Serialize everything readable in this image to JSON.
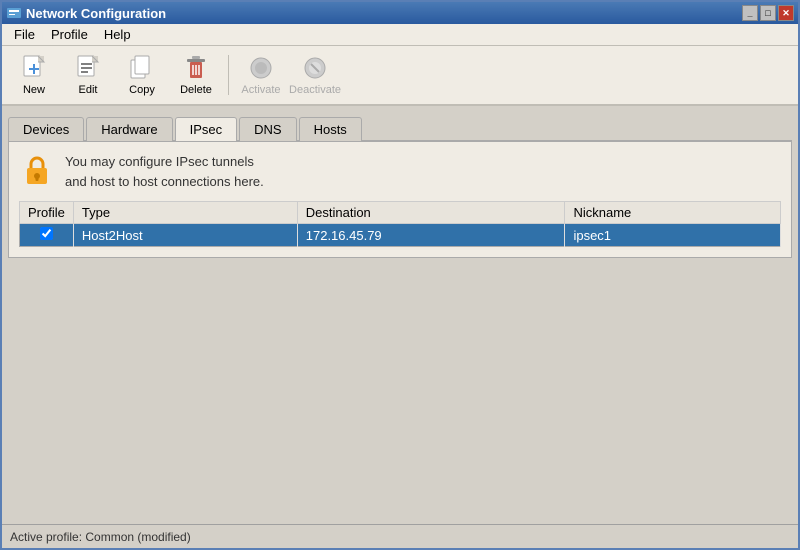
{
  "titlebar": {
    "title": "Network Configuration",
    "minimize_label": "_",
    "maximize_label": "□",
    "close_label": "✕"
  },
  "menubar": {
    "items": [
      {
        "id": "file",
        "label": "File"
      },
      {
        "id": "profile",
        "label": "Profile"
      },
      {
        "id": "help",
        "label": "Help"
      }
    ]
  },
  "toolbar": {
    "new_label": "New",
    "edit_label": "Edit",
    "copy_label": "Copy",
    "delete_label": "Delete",
    "activate_label": "Activate",
    "deactivate_label": "Deactivate"
  },
  "tabs": [
    {
      "id": "devices",
      "label": "Devices"
    },
    {
      "id": "hardware",
      "label": "Hardware"
    },
    {
      "id": "ipsec",
      "label": "IPsec"
    },
    {
      "id": "dns",
      "label": "DNS"
    },
    {
      "id": "hosts",
      "label": "Hosts"
    }
  ],
  "active_tab": "ipsec",
  "info_text_line1": "You may configure IPsec tunnels",
  "info_text_line2": "and host to host connections here.",
  "table": {
    "columns": [
      {
        "id": "profile",
        "label": "Profile"
      },
      {
        "id": "type",
        "label": "Type"
      },
      {
        "id": "destination",
        "label": "Destination"
      },
      {
        "id": "nickname",
        "label": "Nickname"
      }
    ],
    "rows": [
      {
        "checked": true,
        "profile": "",
        "type": "Host2Host",
        "destination": "172.16.45.79",
        "nickname": "ipsec1",
        "selected": true
      }
    ]
  },
  "statusbar": {
    "text": "Active profile: Common (modified)"
  }
}
